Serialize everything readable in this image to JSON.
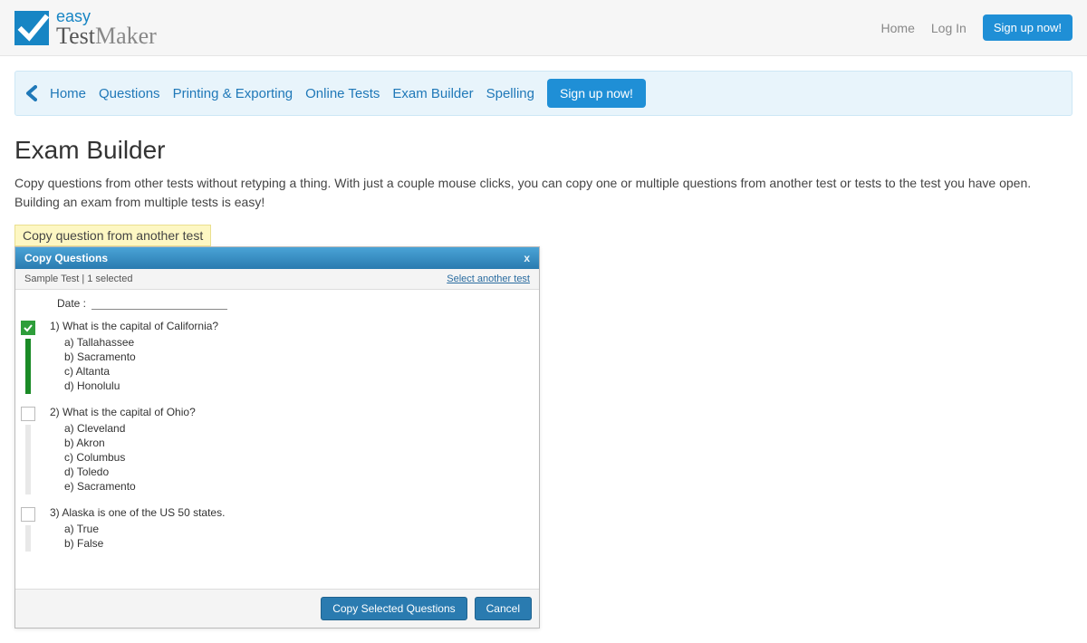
{
  "brand": {
    "easy": "easy",
    "test": "Test",
    "maker": "Maker"
  },
  "top": {
    "home": "Home",
    "login": "Log In",
    "signup": "Sign up now!"
  },
  "nav": {
    "home": "Home",
    "questions": "Questions",
    "printing": "Printing & Exporting",
    "online": "Online Tests",
    "exam": "Exam Builder",
    "spelling": "Spelling",
    "signup": "Sign up now!"
  },
  "page": {
    "title": "Exam Builder",
    "lead": "Copy questions from other tests without retyping a thing. With just a couple mouse clicks, you can copy one or multiple questions from another test or tests to the test you have open. Building an exam from multiple tests is easy!",
    "caption": "Copy question from another test"
  },
  "dialog": {
    "title": "Copy Questions",
    "close": "x",
    "source": "Sample Test | 1 selected",
    "select_another": "Select another test",
    "date_label": "Date :",
    "copy_btn": "Copy Selected Questions",
    "cancel_btn": "Cancel",
    "questions": [
      {
        "selected": true,
        "text": "1) What is the capital of California?",
        "options": [
          "a) Tallahassee",
          "b) Sacramento",
          "c) Altanta",
          "d) Honolulu"
        ]
      },
      {
        "selected": false,
        "text": "2) What is the capital of Ohio?",
        "options": [
          "a) Cleveland",
          "b) Akron",
          "c) Columbus",
          "d) Toledo",
          "e) Sacramento"
        ]
      },
      {
        "selected": false,
        "text": "3) Alaska is one of the US 50 states.",
        "options": [
          "a) True",
          "b) False"
        ]
      }
    ]
  }
}
